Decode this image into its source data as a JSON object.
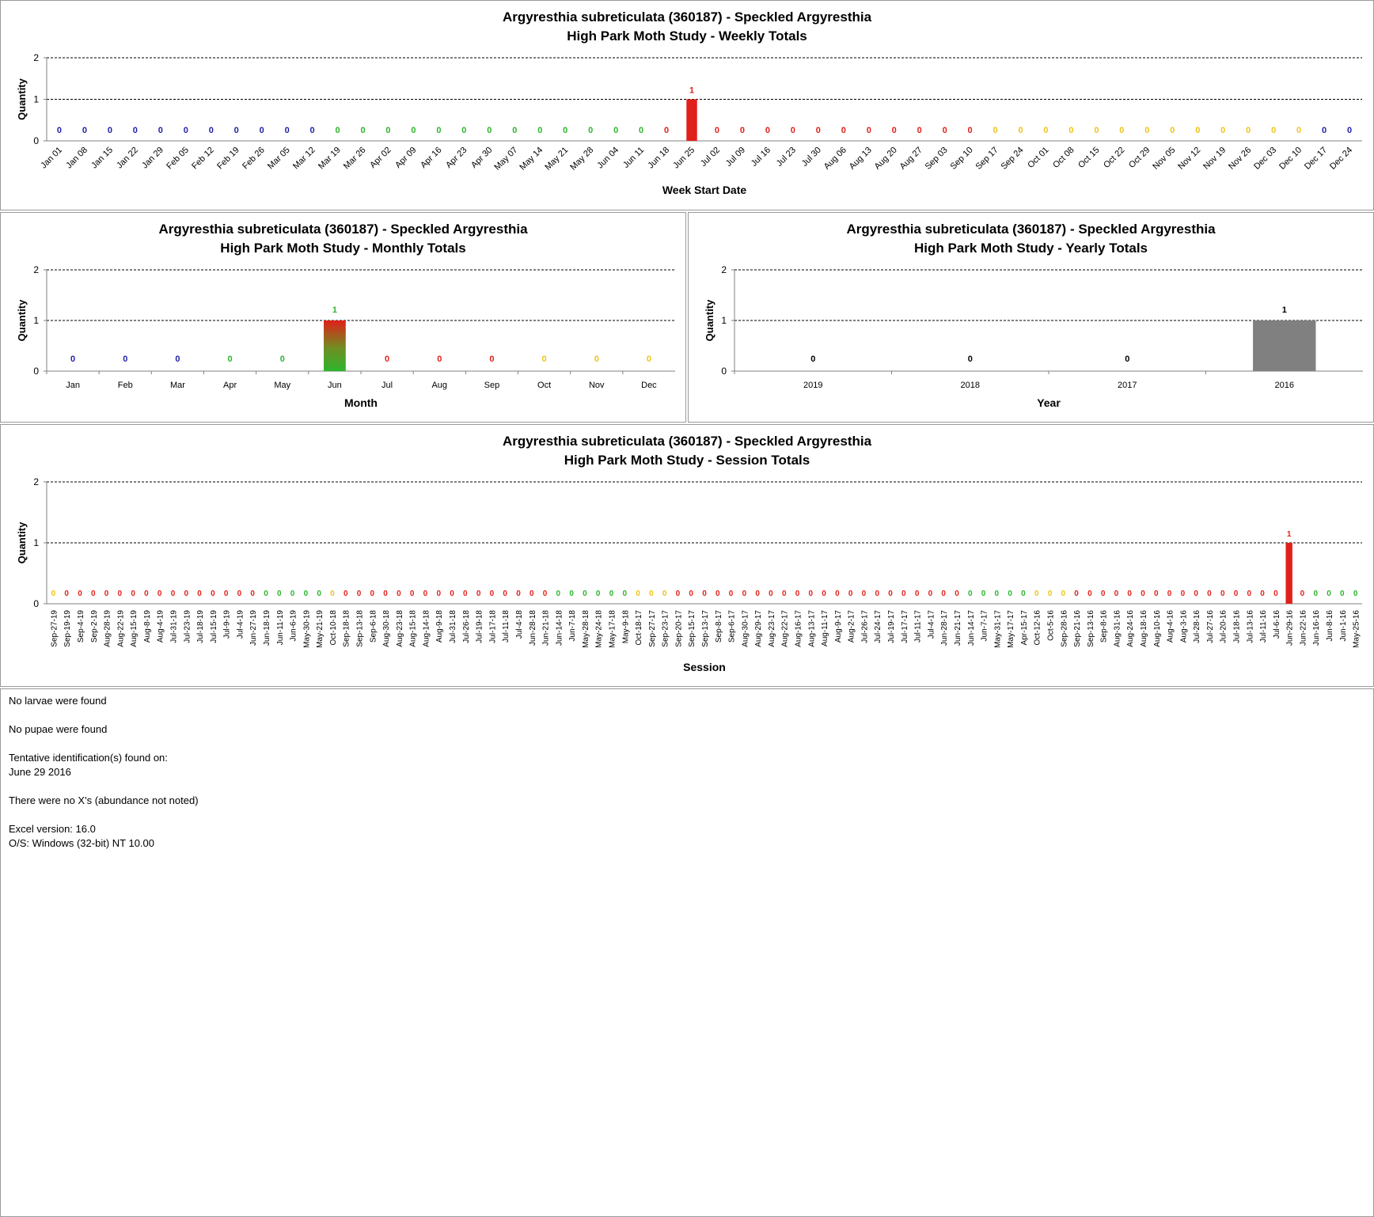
{
  "charts": {
    "weekly": {
      "title1": "Argyresthia subreticulata (360187)  - Speckled Argyresthia",
      "title2": "High Park Moth Study  -  Weekly Totals",
      "xlabel": "Week Start Date",
      "ylabel": "Quantity"
    },
    "monthly": {
      "title1": "Argyresthia subreticulata (360187)  - Speckled Argyresthia",
      "title2": "High Park Moth Study  -  Monthly Totals",
      "xlabel": "Month",
      "ylabel": "Quantity"
    },
    "yearly": {
      "title1": "Argyresthia subreticulata (360187)  - Speckled Argyresthia",
      "title2": "High Park Moth Study  -  Yearly Totals",
      "xlabel": "Year",
      "ylabel": "Quantity"
    },
    "session": {
      "title1": "Argyresthia subreticulata (360187)  - Speckled Argyresthia",
      "title2": "High Park Moth Study  -  Session Totals",
      "xlabel": "Session",
      "ylabel": "Quantity"
    }
  },
  "colors": {
    "blue": "#1f1fa8",
    "green": "#2db52d",
    "red": "#e0201a",
    "yellow": "#f0c419",
    "black": "#000000",
    "grey_bar": "#808080"
  },
  "chart_data": [
    {
      "id": "weekly",
      "type": "bar",
      "ylim": [
        0,
        2
      ],
      "yticks": [
        0,
        1,
        2
      ],
      "grid": true,
      "categories": [
        "Jan 01",
        "Jan 08",
        "Jan 15",
        "Jan 22",
        "Jan 29",
        "Feb 05",
        "Feb 12",
        "Feb 19",
        "Feb 26",
        "Mar 05",
        "Mar 12",
        "Mar 19",
        "Mar 26",
        "Apr 02",
        "Apr 09",
        "Apr 16",
        "Apr 23",
        "Apr 30",
        "May 07",
        "May 14",
        "May 21",
        "May 28",
        "Jun 04",
        "Jun 11",
        "Jun 18",
        "Jun 25",
        "Jul 02",
        "Jul 09",
        "Jul 16",
        "Jul 23",
        "Jul 30",
        "Aug 06",
        "Aug 13",
        "Aug 20",
        "Aug 27",
        "Sep 03",
        "Sep 10",
        "Sep 17",
        "Sep 24",
        "Oct 01",
        "Oct 08",
        "Oct 15",
        "Oct 22",
        "Oct 29",
        "Nov 05",
        "Nov 12",
        "Nov 19",
        "Nov 26",
        "Dec 03",
        "Dec 10",
        "Dec 17",
        "Dec 24"
      ],
      "values": [
        0,
        0,
        0,
        0,
        0,
        0,
        0,
        0,
        0,
        0,
        0,
        0,
        0,
        0,
        0,
        0,
        0,
        0,
        0,
        0,
        0,
        0,
        0,
        0,
        0,
        1,
        0,
        0,
        0,
        0,
        0,
        0,
        0,
        0,
        0,
        0,
        0,
        0,
        0,
        0,
        0,
        0,
        0,
        0,
        0,
        0,
        0,
        0,
        0,
        0,
        0,
        0
      ],
      "label_colors": [
        "blue",
        "blue",
        "blue",
        "blue",
        "blue",
        "blue",
        "blue",
        "blue",
        "blue",
        "blue",
        "blue",
        "green",
        "green",
        "green",
        "green",
        "green",
        "green",
        "green",
        "green",
        "green",
        "green",
        "green",
        "green",
        "green",
        "red",
        "red",
        "red",
        "red",
        "red",
        "red",
        "red",
        "red",
        "red",
        "red",
        "red",
        "red",
        "red",
        "yellow",
        "yellow",
        "yellow",
        "yellow",
        "yellow",
        "yellow",
        "yellow",
        "yellow",
        "yellow",
        "yellow",
        "yellow",
        "yellow",
        "yellow",
        "blue",
        "blue"
      ],
      "bar_color": "red"
    },
    {
      "id": "monthly",
      "type": "bar",
      "ylim": [
        0,
        2
      ],
      "yticks": [
        0,
        1,
        2
      ],
      "grid": true,
      "categories": [
        "Jan",
        "Feb",
        "Mar",
        "Apr",
        "May",
        "Jun",
        "Jul",
        "Aug",
        "Sep",
        "Oct",
        "Nov",
        "Dec"
      ],
      "values": [
        0,
        0,
        0,
        0,
        0,
        1,
        0,
        0,
        0,
        0,
        0,
        0
      ],
      "label_colors": [
        "blue",
        "blue",
        "blue",
        "green",
        "green",
        "green",
        "red",
        "red",
        "red",
        "yellow",
        "yellow",
        "yellow"
      ],
      "bar_color": "gradient-red-green"
    },
    {
      "id": "yearly",
      "type": "bar",
      "ylim": [
        0,
        2
      ],
      "yticks": [
        0,
        1,
        2
      ],
      "grid": true,
      "categories": [
        "2019",
        "2018",
        "2017",
        "2016"
      ],
      "values": [
        0,
        0,
        0,
        1
      ],
      "label_colors": [
        "black",
        "black",
        "black",
        "black"
      ],
      "bar_color": "grey_bar"
    },
    {
      "id": "session",
      "type": "bar",
      "ylim": [
        0,
        2
      ],
      "yticks": [
        0,
        1,
        2
      ],
      "grid": true,
      "categories": [
        "Sep-27-19",
        "Sep-19-19",
        "Sep-4-19",
        "Sep-2-19",
        "Aug-28-19",
        "Aug-22-19",
        "Aug-15-19",
        "Aug-8-19",
        "Aug-4-19",
        "Jul-31-19",
        "Jul-23-19",
        "Jul-18-19",
        "Jul-15-19",
        "Jul-9-19",
        "Jul-4-19",
        "Jun-27-19",
        "Jun-18-19",
        "Jun-11-19",
        "Jun-6-19",
        "May-30-19",
        "May-21-19",
        "Oct-10-18",
        "Sep-18-18",
        "Sep-13-18",
        "Sep-6-18",
        "Aug-30-18",
        "Aug-23-18",
        "Aug-15-18",
        "Aug-14-18",
        "Aug-9-18",
        "Jul-31-18",
        "Jul-26-18",
        "Jul-19-18",
        "Jul-17-18",
        "Jul-11-18",
        "Jul-4-18",
        "Jun-28-18",
        "Jun-21-18",
        "Jun-14-18",
        "Jun-7-18",
        "May-28-18",
        "May-24-18",
        "May-17-18",
        "May-9-18",
        "Oct-18-17",
        "Sep-27-17",
        "Sep-23-17",
        "Sep-20-17",
        "Sep-15-17",
        "Sep-13-17",
        "Sep-8-17",
        "Sep-6-17",
        "Aug-30-17",
        "Aug-29-17",
        "Aug-23-17",
        "Aug-22-17",
        "Aug-16-17",
        "Aug-13-17",
        "Aug-11-17",
        "Aug-9-17",
        "Aug-2-17",
        "Jul-26-17",
        "Jul-24-17",
        "Jul-19-17",
        "Jul-17-17",
        "Jul-11-17",
        "Jul-4-17",
        "Jun-28-17",
        "Jun-21-17",
        "Jun-14-17",
        "Jun-7-17",
        "May-31-17",
        "May-17-17",
        "Apr-15-17",
        "Oct-12-16",
        "Oct-5-16",
        "Sep-28-16",
        "Sep-21-16",
        "Sep-13-16",
        "Sep-8-16",
        "Aug-31-16",
        "Aug-24-16",
        "Aug-18-16",
        "Aug-10-16",
        "Aug-4-16",
        "Aug-3-16",
        "Jul-28-16",
        "Jul-27-16",
        "Jul-20-16",
        "Jul-18-16",
        "Jul-13-16",
        "Jul-11-16",
        "Jul-6-16",
        "Jun-29-16",
        "Jun-22-16",
        "Jun-16-16",
        "Jun-8-16",
        "Jun-1-16",
        "May-25-16"
      ],
      "values": [
        0,
        0,
        0,
        0,
        0,
        0,
        0,
        0,
        0,
        0,
        0,
        0,
        0,
        0,
        0,
        0,
        0,
        0,
        0,
        0,
        0,
        0,
        0,
        0,
        0,
        0,
        0,
        0,
        0,
        0,
        0,
        0,
        0,
        0,
        0,
        0,
        0,
        0,
        0,
        0,
        0,
        0,
        0,
        0,
        0,
        0,
        0,
        0,
        0,
        0,
        0,
        0,
        0,
        0,
        0,
        0,
        0,
        0,
        0,
        0,
        0,
        0,
        0,
        0,
        0,
        0,
        0,
        0,
        0,
        0,
        0,
        0,
        0,
        0,
        0,
        0,
        0,
        0,
        0,
        0,
        0,
        0,
        0,
        0,
        0,
        0,
        0,
        0,
        0,
        0,
        0,
        0,
        0,
        1,
        0,
        0,
        0,
        0,
        0
      ],
      "label_colors": [
        "yellow",
        "red",
        "red",
        "red",
        "red",
        "red",
        "red",
        "red",
        "red",
        "red",
        "red",
        "red",
        "red",
        "red",
        "red",
        "red",
        "green",
        "green",
        "green",
        "green",
        "green",
        "yellow",
        "red",
        "red",
        "red",
        "red",
        "red",
        "red",
        "red",
        "red",
        "red",
        "red",
        "red",
        "red",
        "red",
        "red",
        "red",
        "red",
        "green",
        "green",
        "green",
        "green",
        "green",
        "green",
        "yellow",
        "yellow",
        "yellow",
        "red",
        "red",
        "red",
        "red",
        "red",
        "red",
        "red",
        "red",
        "red",
        "red",
        "red",
        "red",
        "red",
        "red",
        "red",
        "red",
        "red",
        "red",
        "red",
        "red",
        "red",
        "red",
        "green",
        "green",
        "green",
        "green",
        "green",
        "yellow",
        "yellow",
        "yellow",
        "red",
        "red",
        "red",
        "red",
        "red",
        "red",
        "red",
        "red",
        "red",
        "red",
        "red",
        "red",
        "red",
        "red",
        "red",
        "red",
        "red",
        "red",
        "green",
        "green",
        "green",
        "green"
      ],
      "bar_color": "red"
    }
  ],
  "notes": {
    "larvae": "No larvae were found",
    "pupae": "No pupae were found",
    "tentative_header": "Tentative identification(s) found on:",
    "tentative_date": "June 29 2016",
    "xs": "There were no X's (abundance not noted)",
    "excel": "Excel version: 16.0",
    "os": "O/S: Windows (32-bit) NT 10.00"
  }
}
